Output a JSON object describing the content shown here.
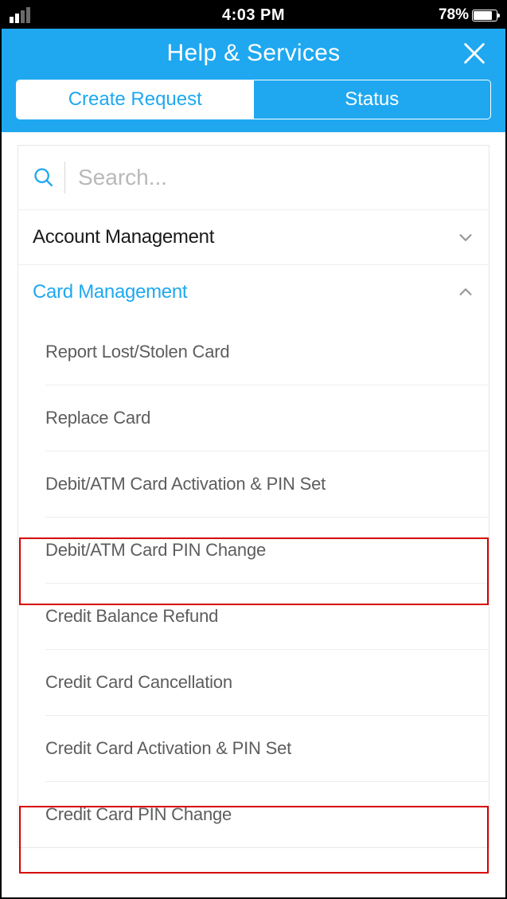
{
  "status_bar": {
    "time": "4:03 PM",
    "battery_pct": "78%"
  },
  "header": {
    "title": "Help & Services"
  },
  "tabs": {
    "create": "Create Request",
    "status": "Status"
  },
  "search": {
    "placeholder": "Search..."
  },
  "categories": {
    "account": "Account Management",
    "card": "Card Management"
  },
  "card_items": [
    "Report Lost/Stolen Card",
    "Replace Card",
    "Debit/ATM Card Activation & PIN Set",
    "Debit/ATM Card PIN Change",
    "Credit Balance Refund",
    "Credit Card Cancellation",
    "Credit Card Activation & PIN Set",
    "Credit Card PIN Change"
  ]
}
